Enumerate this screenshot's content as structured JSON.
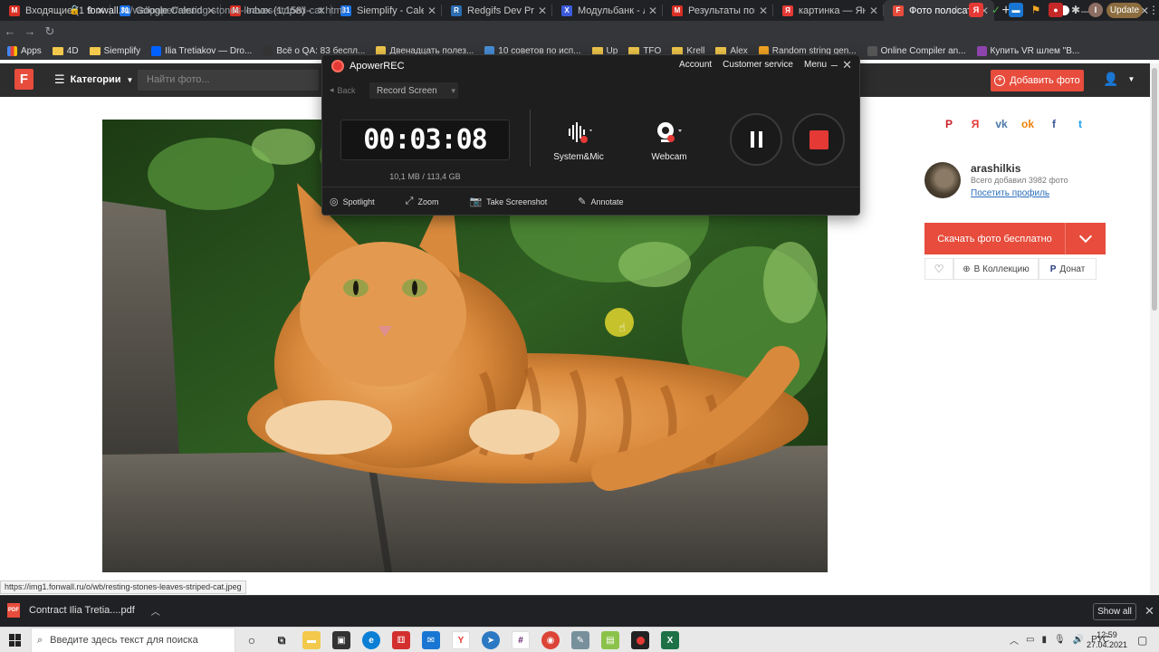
{
  "browser": {
    "tabs": [
      {
        "label": "Входящие (1 952) - ili",
        "icon": "gmail-icon",
        "color": "#d93025",
        "glyph": "M"
      },
      {
        "label": "Google Calendar - We",
        "icon": "calendar-icon",
        "color": "#1a73e8",
        "glyph": "31"
      },
      {
        "label": "Inbox (1,158) - ilia.tret",
        "icon": "gmail-icon",
        "color": "#d93025",
        "glyph": "M"
      },
      {
        "label": "Siemplify - Calendar -",
        "icon": "calendar-icon",
        "color": "#1a73e8",
        "glyph": "31"
      },
      {
        "label": "Redgifs Dev Product E",
        "icon": "doc-icon",
        "color": "#2b6cb0",
        "glyph": "R"
      },
      {
        "label": "Модульбанк - Личны",
        "icon": "bank-icon",
        "color": "#3b5bdb",
        "glyph": "X"
      },
      {
        "label": "Результаты поиска -",
        "icon": "gmail-icon",
        "color": "#d93025",
        "glyph": "M"
      },
      {
        "label": "картинка — Яндекс: н",
        "icon": "yandex-icon",
        "color": "#e53935",
        "glyph": "Я"
      },
      {
        "label": "Фото полосатый кот",
        "icon": "fonwall-icon",
        "color": "#e74c3c",
        "glyph": "F",
        "active": true
      }
    ],
    "close_glyph": "✕",
    "new_tab_glyph": "+",
    "window_controls": [
      "—",
      "❐",
      "✕"
    ],
    "url_host": "fonwall.ru",
    "url_path": "/wallpaper/resting-stones-leaves-striped-cat.html",
    "update_label": "Update",
    "bookmarks": [
      {
        "label": "Apps",
        "type": "apps"
      },
      {
        "label": "4D",
        "type": "folder"
      },
      {
        "label": "Siemplify",
        "type": "folder"
      },
      {
        "label": "Ilia Tretiakov — Dro...",
        "type": "site",
        "color": "#0061ff"
      },
      {
        "label": "Всё о QA: 83 беспл...",
        "type": "site",
        "color": "#333"
      },
      {
        "label": "Двенадцать полез...",
        "type": "site",
        "color": "#f2c94c"
      },
      {
        "label": "10 советов по исп...",
        "type": "site",
        "color": "#4a90d9"
      },
      {
        "label": "Up",
        "type": "folder"
      },
      {
        "label": "TFO",
        "type": "folder"
      },
      {
        "label": "Krell",
        "type": "folder"
      },
      {
        "label": "Alex",
        "type": "folder"
      },
      {
        "label": "Random string gen...",
        "type": "site",
        "color": "#f5a623"
      },
      {
        "label": "Online Compiler an...",
        "type": "site",
        "color": "#555"
      },
      {
        "label": "Купить VR шлем \"В...",
        "type": "site",
        "color": "#8e44ad"
      }
    ]
  },
  "site": {
    "logo": "F",
    "categories_label": "Категории",
    "search_placeholder": "Найти фото...",
    "add_photo_label": "Добавить фото",
    "accent": "#e74c3c",
    "share": [
      {
        "name": "pinterest-icon",
        "glyph": "P",
        "color": "#cb2027"
      },
      {
        "name": "yandex-icon",
        "glyph": "Я",
        "color": "#e53935"
      },
      {
        "name": "vk-icon",
        "glyph": "vk",
        "color": "#4a76a8"
      },
      {
        "name": "odnoklassniki-icon",
        "glyph": "ok",
        "color": "#ee8208"
      },
      {
        "name": "facebook-icon",
        "glyph": "f",
        "color": "#3b5998"
      },
      {
        "name": "twitter-icon",
        "glyph": "t",
        "color": "#1da1f2"
      }
    ],
    "author": {
      "name": "arashilkis",
      "count": "Всего добавил 3982 фото",
      "profile_link": "Посетить профиль"
    },
    "download_label": "Скачать фото бесплатно",
    "actions": {
      "collection": "В Коллекцию",
      "donate": "Донат"
    }
  },
  "status_url": "https://img1.fonwall.ru/o/wb/resting-stones-leaves-striped-cat.jpeg",
  "downloads": {
    "file": "Contract Ilia Tretia....pdf",
    "show_all": "Show all"
  },
  "taskbar": {
    "search_placeholder": "Введите здесь текст для поиска",
    "lang": "РУС",
    "time": "12:59",
    "date": "27.04.2021"
  },
  "recorder": {
    "title": "ApowerREC",
    "menu": [
      "Account",
      "Customer service",
      "Menu"
    ],
    "back": "Back",
    "mode": "Record Screen",
    "timer": "00:03:08",
    "size": "10,1 MB / 113,4 GB",
    "audio_label": "System&Mic",
    "webcam_label": "Webcam",
    "tools": [
      "Spotlight",
      "Zoom",
      "Take Screenshot",
      "Annotate"
    ]
  }
}
